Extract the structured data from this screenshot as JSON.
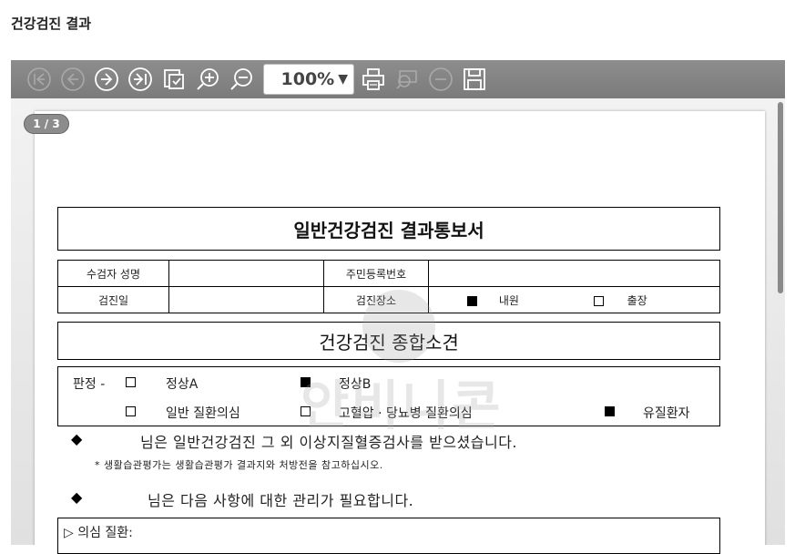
{
  "page": {
    "title": "건강검진 결과"
  },
  "toolbar": {
    "buttons": [
      {
        "icon": "first-page-icon"
      },
      {
        "icon": "prev-page-icon"
      },
      {
        "icon": "next-page-icon"
      },
      {
        "icon": "last-page-icon"
      },
      {
        "icon": "export-icon"
      },
      {
        "icon": "zoom-in-icon"
      },
      {
        "icon": "zoom-out-icon"
      }
    ],
    "zoom_value": "100%",
    "right_buttons": [
      {
        "icon": "print-icon"
      },
      {
        "icon": "print-preview-icon"
      },
      {
        "icon": "close-icon"
      },
      {
        "icon": "save-icon"
      }
    ]
  },
  "viewer": {
    "page_indicator": "1 / 3"
  },
  "document": {
    "title": "일반건강검진 결과통보서",
    "info": {
      "name_label": "수검자 성명",
      "name_value": "",
      "id_label": "주민등록번호",
      "id_value": "",
      "date_label": "검진일",
      "date_value": "",
      "place_label": "검진장소",
      "place_option1": "내원",
      "place_option2": "출장"
    },
    "section_title": "건강검진 종합소견",
    "judgement": {
      "label": "판정 -",
      "opt1": "정상A",
      "opt2": "정상B",
      "opt3": "일반 질환의심",
      "opt4": "고혈압 · 당뇨병 질환의심",
      "opt5": "유질환자"
    },
    "line1": "님은 일반건강검진 그 외 이상지질혈증검사를 받으셨습니다.",
    "note": "* 생활습관평가는 생활습관평가 결과지와 처방전을 참고하십시오.",
    "line2": "님은 다음 사항에 대한 관리가 필요합니다.",
    "opinion_label": "▷ 의심 질환:"
  },
  "watermark": {
    "text": "안비니콘"
  }
}
